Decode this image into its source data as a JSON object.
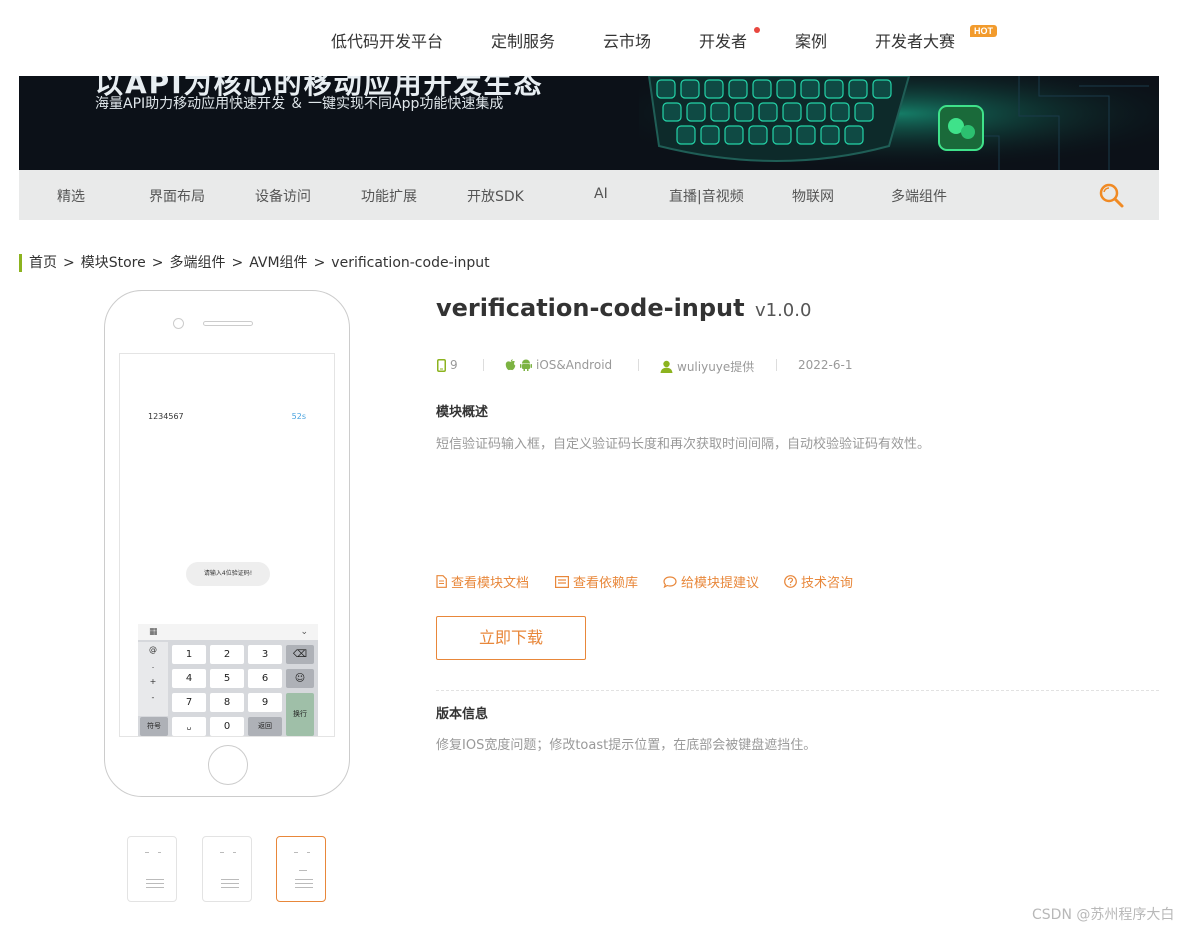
{
  "topnav": {
    "items": [
      "低代码开发平台",
      "定制服务",
      "云市场",
      "开发者",
      "案例",
      "开发者大赛"
    ],
    "hot_badge": "HOT",
    "dot_color": "#e8473f"
  },
  "banner": {
    "title": "以API为核心的移动应用开发生态",
    "subtitle": "海量API助力移动应用快速开发 ＆ 一键实现不同App功能快速集成"
  },
  "categories": [
    "精选",
    "界面布局",
    "设备访问",
    "功能扩展",
    "开放SDK",
    "AI",
    "直播|音视频",
    "物联网",
    "多端组件"
  ],
  "breadcrumb": {
    "items": [
      "首页",
      "模块Store",
      "多端组件",
      "AVM组件",
      "verification-code-input"
    ],
    "separator": ">"
  },
  "phone_preview": {
    "code": "1234567",
    "timer": "52s",
    "toast": "请输入4位验证码!",
    "keys": [
      "1",
      "2",
      "3",
      "4",
      "5",
      "6",
      "7",
      "8",
      "9",
      "0"
    ],
    "side_keys": [
      "@",
      ".",
      "+",
      "-"
    ],
    "key_symbol": "符号",
    "key_return": "返回",
    "key_newline": "换行"
  },
  "module": {
    "name": "verification-code-input",
    "version": "v1.0.0",
    "phone_count": "9",
    "platforms": "iOS&Android",
    "provider": "wuliyuye提供",
    "date": "2022-6-1",
    "overview_heading": "模块概述",
    "overview_text": "短信验证码输入框，自定义验证码长度和再次获取时间间隔，自动校验验证码有效性。",
    "links": [
      "查看模块文档",
      "查看依赖库",
      "给模块提建议",
      "技术咨询"
    ],
    "download_label": "立即下载",
    "version_heading": "版本信息",
    "version_text": "修复IOS宽度问题；修改toast提示位置，在底部会被键盘遮挡住。"
  },
  "watermark": "CSDN @苏州程序大白",
  "colors": {
    "accent": "#e8873a",
    "brand_green": "#8cb31f",
    "android_green": "#7cb342"
  },
  "thumbnail_count": 3,
  "active_thumbnail": 3
}
